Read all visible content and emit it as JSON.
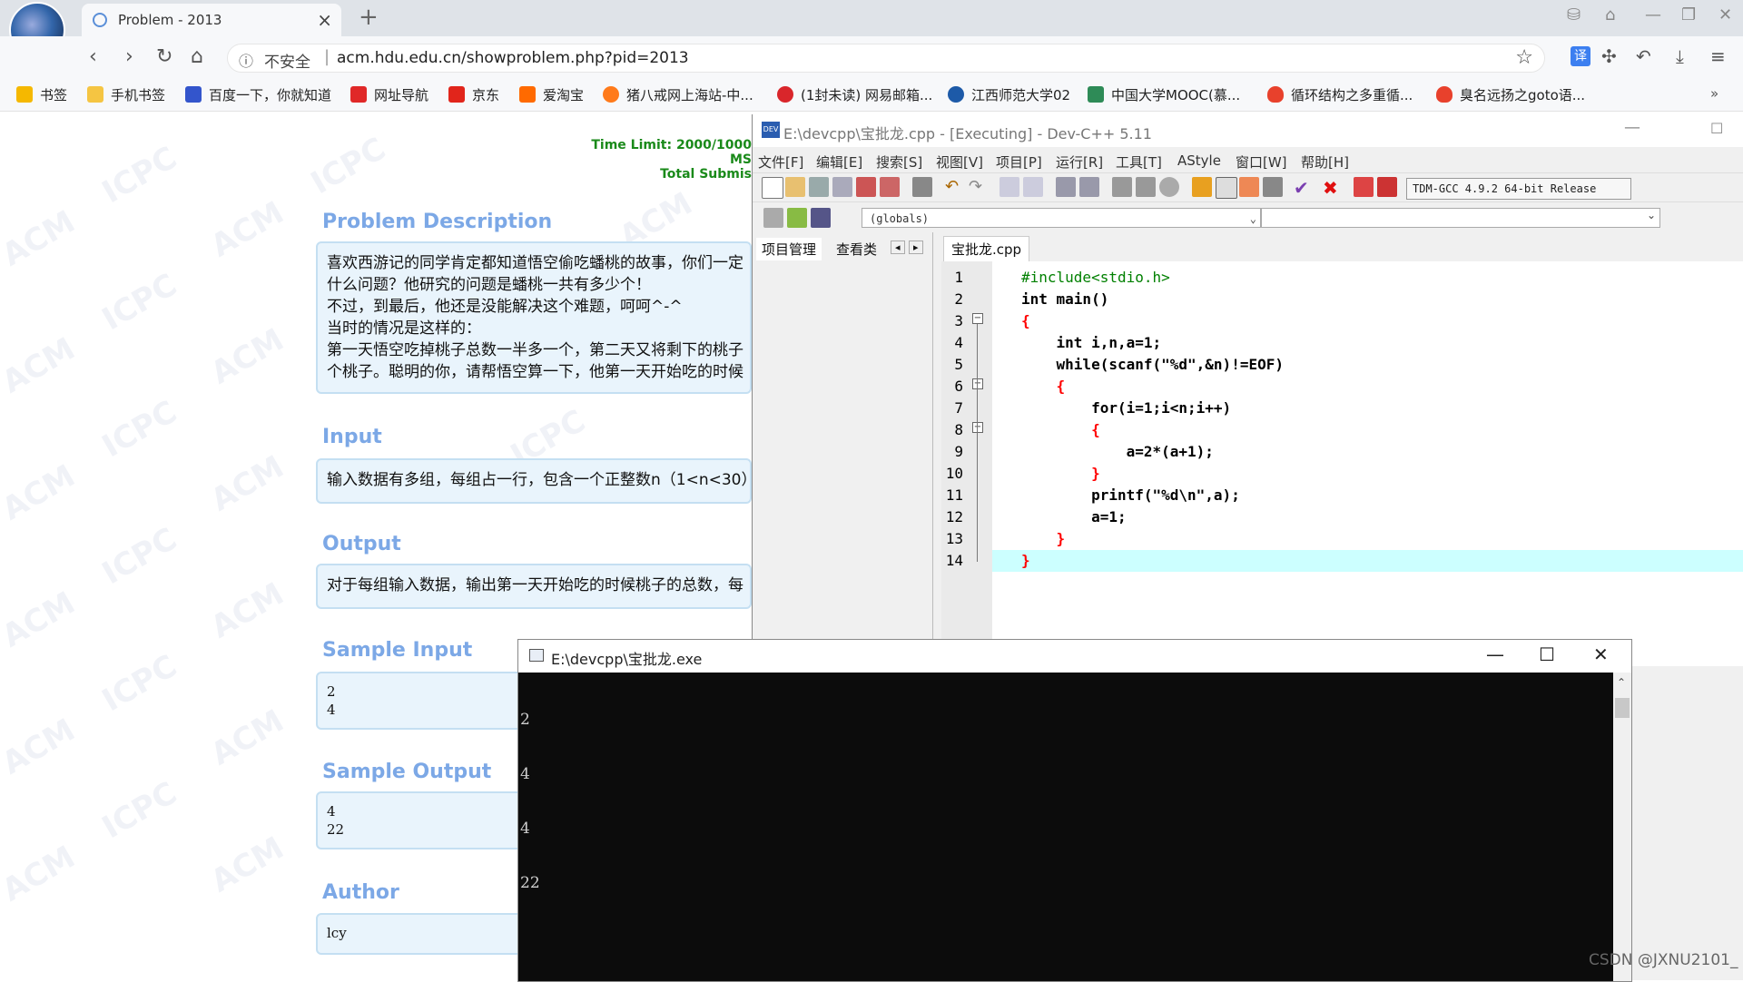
{
  "browser": {
    "tab_title": "Problem - 2013",
    "tab_close": "×",
    "new_tab": "+",
    "security_label": "不安全",
    "url": "acm.hdu.edu.cn/showproblem.php?pid=2013",
    "translate_label": "译",
    "bookmarks": [
      "书签",
      "手机书签",
      "百度一下，你就知道",
      "网址导航",
      "京东",
      "爱淘宝",
      "猪八戒网上海站-中...",
      "(1封未读) 网易邮箱...",
      "江西师范大学02",
      "中国大学MOOC(慕...",
      "循环结构之多重循...",
      "臭名远扬之goto语..."
    ]
  },
  "problem": {
    "time_limit": "Time Limit: 2000/1000 MS",
    "total_submissions": "Total Submis",
    "description_title": "Problem Description",
    "description_lines": [
      "喜欢西游记的同学肯定都知道悟空偷吃蟠桃的故事，你们一定",
      "什么问题？他研究的问题是蟠桃一共有多少个！",
      "不过，到最后，他还是没能解决这个难题，呵呵^-^",
      "当时的情况是这样的：",
      "第一天悟空吃掉桃子总数一半多一个，第二天又将剩下的桃子",
      "个桃子。聪明的你，请帮悟空算一下，他第一天开始吃的时候"
    ],
    "input_title": "Input",
    "input_text": "输入数据有多组，每组占一行，包含一个正整数n（1<n<30）",
    "output_title": "Output",
    "output_text": "对于每组输入数据，输出第一天开始吃的时候桃子的总数，每",
    "sample_input_title": "Sample Input",
    "sample_input_lines": [
      "2",
      "4"
    ],
    "sample_output_title": "Sample Output",
    "sample_output_lines": [
      "4",
      "22"
    ],
    "author_title": "Author",
    "author": "lcy",
    "watermark_acm": "ACM",
    "watermark_icpc": "ICPC"
  },
  "devcpp": {
    "title": "E:\\devcpp\\宝批龙.cpp - [Executing] - Dev-C++ 5.11",
    "menu": [
      "文件[F]",
      "编辑[E]",
      "搜索[S]",
      "视图[V]",
      "项目[P]",
      "运行[R]",
      "工具[T]",
      "AStyle",
      "窗口[W]",
      "帮助[H]"
    ],
    "compiler": "TDM-GCC 4.9.2 64-bit Release",
    "scope": "(globals)",
    "left_tabs": [
      "项目管理",
      "查看类"
    ],
    "file_tab": "宝批龙.cpp",
    "line_numbers": [
      "1",
      "2",
      "3",
      "4",
      "5",
      "6",
      "7",
      "8",
      "9",
      "10",
      "11",
      "12",
      "13",
      "14"
    ],
    "code_lines": [
      "#include<stdio.h>",
      "int main()",
      "{",
      "    int i,n,a=1;",
      "    while(scanf(\"%d\",&n)!=EOF)",
      "    {",
      "        for(i=1;i<n;i++)",
      "        {",
      "            a=2*(a+1);",
      "        }",
      "        printf(\"%d\\n\",a);",
      "        a=1;",
      "    }",
      "}"
    ]
  },
  "console": {
    "title": "E:\\devcpp\\宝批龙.exe",
    "output_lines": [
      "2",
      "4",
      "4",
      "22"
    ]
  },
  "watermark": "CSDN @JXNU2101_",
  "colors": {
    "heading": "#7ca8e6",
    "box_bg": "#e9f4fc",
    "keyword": "#000000",
    "string": "#0000ff",
    "preprocessor": "#008000",
    "brace": "#ff0000",
    "current_line": "#ccffff"
  }
}
